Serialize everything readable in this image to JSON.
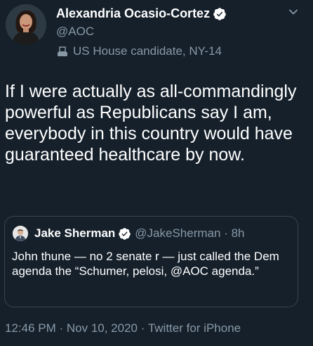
{
  "author": {
    "name": "Alexandria Ocasio-Cortez",
    "handle": "@AOC",
    "label": "US House candidate, NY-14",
    "verified_color": "#1da1f2"
  },
  "tweet": {
    "text": "If I were actually as all-commandingly powerful as Republicans say I am, everybody in this country would have guaranteed healthcare by now."
  },
  "quote": {
    "name": "Jake Sherman",
    "handle": "@JakeSherman",
    "separator": " · ",
    "time": "8h",
    "text": "John thune — no 2 senate r — just called the Dem agenda the “Schumer, pelosi, @AOC agenda.”"
  },
  "meta": {
    "time": "12:46 PM",
    "separator": " · ",
    "date": "Nov 10, 2020",
    "source": "Twitter for iPhone"
  },
  "colors": {
    "background": "#15202b",
    "secondary_text": "#8899a6",
    "border": "#38444d"
  },
  "icons": [
    "verified-badge-icon",
    "chevron-down-icon",
    "ballot-box-icon"
  ]
}
